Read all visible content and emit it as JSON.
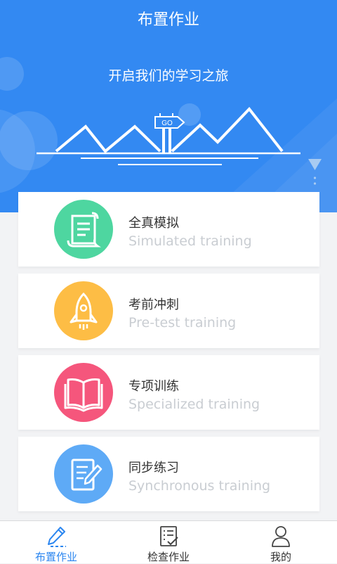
{
  "header": {
    "title": "布置作业",
    "slogan": "开启我们的学习之旅",
    "sign_text": "GO",
    "bg_color": "#3389f2"
  },
  "cards": [
    {
      "cn": "全真模拟",
      "en": "Simulated training",
      "icon": "scroll-icon",
      "color": "#4ed6a0"
    },
    {
      "cn": "考前冲刺",
      "en": "Pre-test training",
      "icon": "rocket-icon",
      "color": "#fdbd45"
    },
    {
      "cn": "专项训练",
      "en": "Specialized training",
      "icon": "book-icon",
      "color": "#f5567c"
    },
    {
      "cn": "同步练习",
      "en": "Synchronous training",
      "icon": "notepad-pen-icon",
      "color": "#5eaaf6"
    }
  ],
  "tabbar": {
    "active_color": "#2b86f0",
    "items": [
      {
        "label": "布置作业",
        "icon": "pen-icon",
        "active": true
      },
      {
        "label": "检查作业",
        "icon": "checklist-icon",
        "active": false
      },
      {
        "label": "我的",
        "icon": "user-icon",
        "active": false
      }
    ]
  }
}
